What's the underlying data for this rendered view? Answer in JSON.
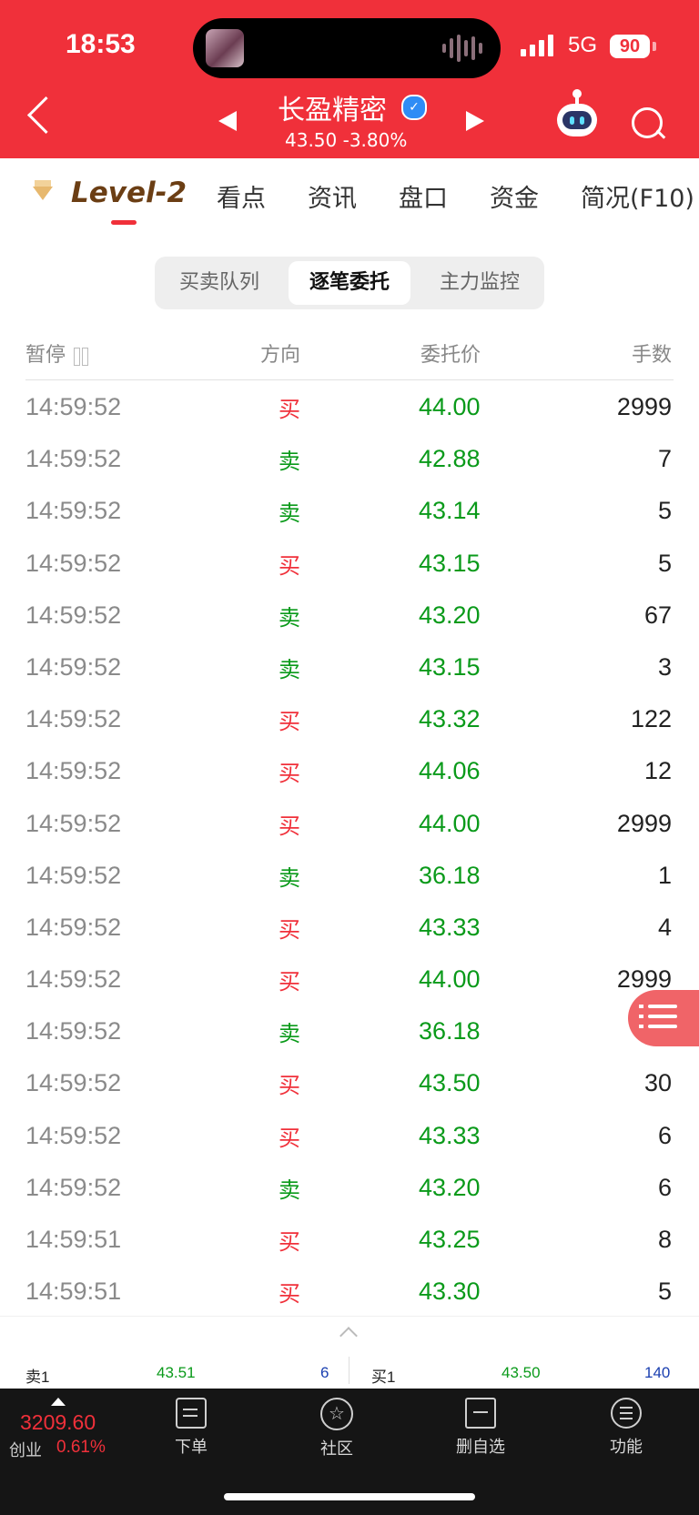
{
  "status_bar": {
    "time": "18:53",
    "network": "5G",
    "battery": "90"
  },
  "header": {
    "stock_name": "长盈精密",
    "price_change": "43.50 -3.80%"
  },
  "tabs": [
    {
      "label": "Level-2",
      "active": true
    },
    {
      "label": "看点"
    },
    {
      "label": "资讯"
    },
    {
      "label": "盘口"
    },
    {
      "label": "资金"
    },
    {
      "label": "简况(F10)"
    }
  ],
  "segments": [
    {
      "label": "买卖队列"
    },
    {
      "label": "逐笔委托",
      "active": true
    },
    {
      "label": "主力监控"
    }
  ],
  "columns": {
    "time": "暂停",
    "direction": "方向",
    "price": "委托价",
    "qty": "手数"
  },
  "rows": [
    {
      "time": "14:59:52",
      "dir": "买",
      "price": "44.00",
      "qty": "2999"
    },
    {
      "time": "14:59:52",
      "dir": "卖",
      "price": "42.88",
      "qty": "7"
    },
    {
      "time": "14:59:52",
      "dir": "卖",
      "price": "43.14",
      "qty": "5"
    },
    {
      "time": "14:59:52",
      "dir": "买",
      "price": "43.15",
      "qty": "5"
    },
    {
      "time": "14:59:52",
      "dir": "卖",
      "price": "43.20",
      "qty": "67"
    },
    {
      "time": "14:59:52",
      "dir": "卖",
      "price": "43.15",
      "qty": "3"
    },
    {
      "time": "14:59:52",
      "dir": "买",
      "price": "43.32",
      "qty": "122"
    },
    {
      "time": "14:59:52",
      "dir": "买",
      "price": "44.06",
      "qty": "12"
    },
    {
      "time": "14:59:52",
      "dir": "买",
      "price": "44.00",
      "qty": "2999"
    },
    {
      "time": "14:59:52",
      "dir": "卖",
      "price": "36.18",
      "qty": "1"
    },
    {
      "time": "14:59:52",
      "dir": "买",
      "price": "43.33",
      "qty": "4"
    },
    {
      "time": "14:59:52",
      "dir": "买",
      "price": "44.00",
      "qty": "2999"
    },
    {
      "time": "14:59:52",
      "dir": "卖",
      "price": "36.18",
      "qty": "2"
    },
    {
      "time": "14:59:52",
      "dir": "买",
      "price": "43.50",
      "qty": "30"
    },
    {
      "time": "14:59:52",
      "dir": "买",
      "price": "43.33",
      "qty": "6"
    },
    {
      "time": "14:59:52",
      "dir": "卖",
      "price": "43.20",
      "qty": "6"
    },
    {
      "time": "14:59:51",
      "dir": "买",
      "price": "43.25",
      "qty": "8"
    },
    {
      "time": "14:59:51",
      "dir": "买",
      "price": "43.30",
      "qty": "5"
    }
  ],
  "quote": {
    "sell_label": "卖1",
    "sell_price": "43.51",
    "sell_qty": "6",
    "buy_label": "买1",
    "buy_price": "43.50",
    "buy_qty": "140"
  },
  "index": {
    "value": "3209.60",
    "name": "创业",
    "pct": "0.61%"
  },
  "bottom_nav": [
    {
      "label": "下单",
      "icon": "order-icon"
    },
    {
      "label": "社区",
      "icon": "community-icon"
    },
    {
      "label": "删自选",
      "icon": "remove-watchlist-icon"
    },
    {
      "label": "功能",
      "icon": "menu-icon"
    }
  ],
  "colors": {
    "brand_red": "#f0303a",
    "up_red": "#f0303a",
    "down_green": "#0a9a1a"
  }
}
